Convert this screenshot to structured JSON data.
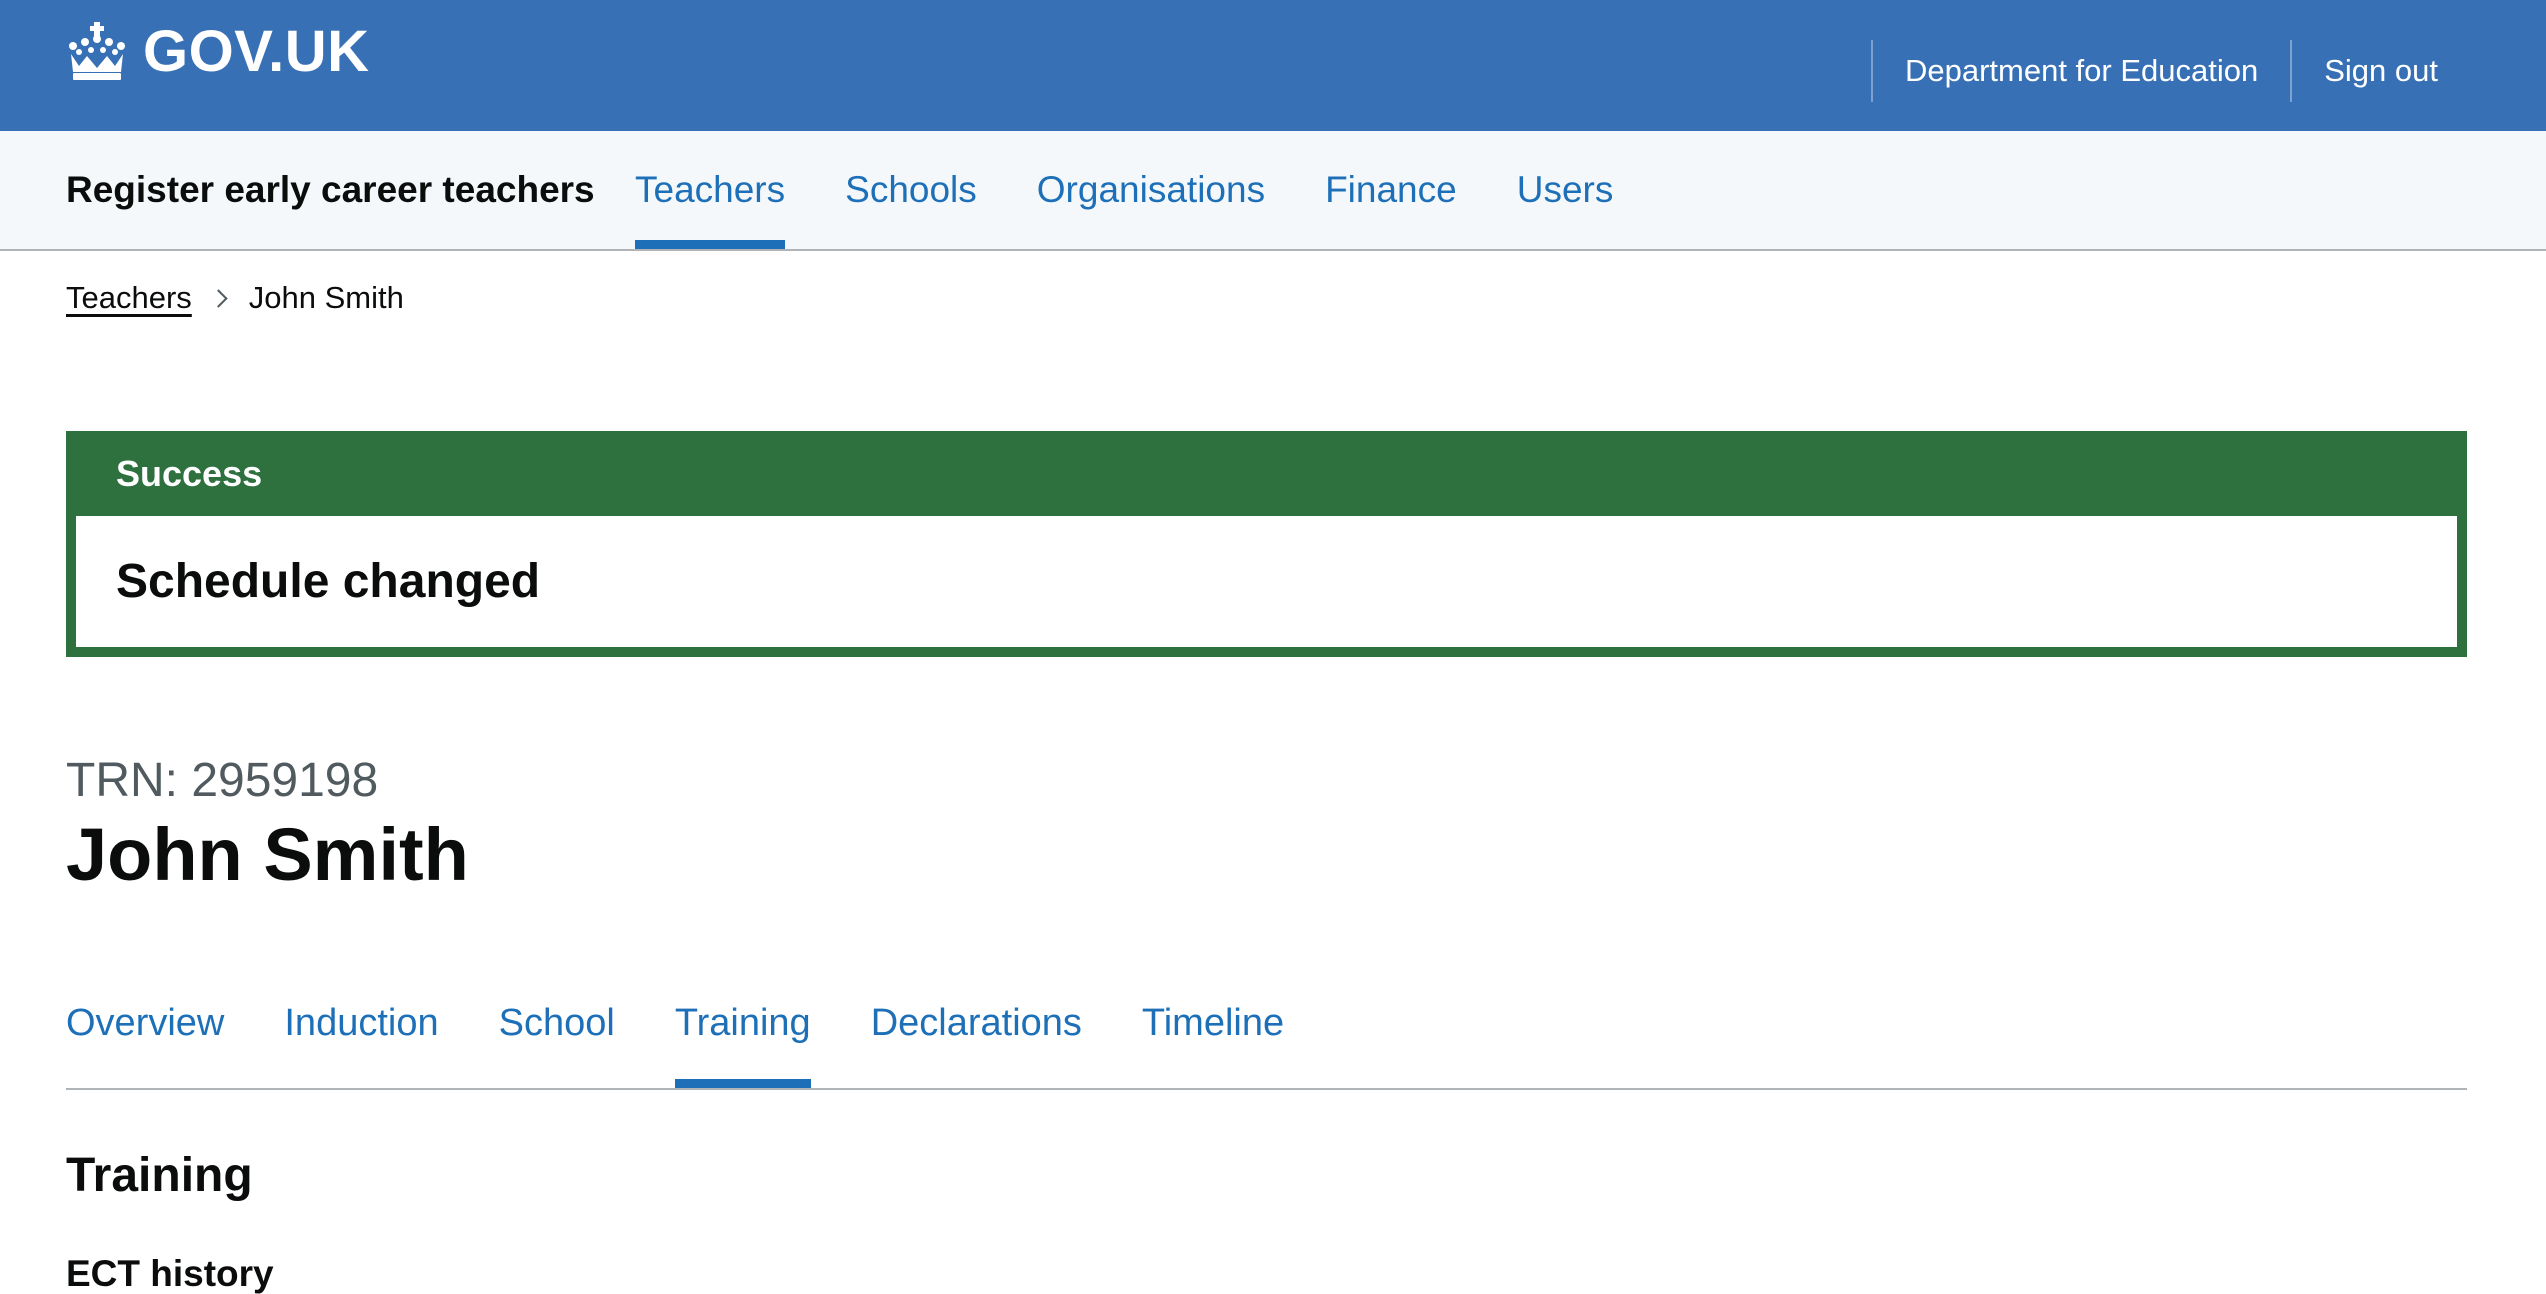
{
  "header": {
    "logo_text": "GOV.UK",
    "logo_icon": "crown-icon",
    "links": [
      {
        "label": "Department for Education"
      },
      {
        "label": "Sign out"
      }
    ]
  },
  "service_nav": {
    "service_name": "Register early career teachers",
    "items": [
      {
        "label": "Teachers",
        "active": true
      },
      {
        "label": "Schools",
        "active": false
      },
      {
        "label": "Organisations",
        "active": false
      },
      {
        "label": "Finance",
        "active": false
      },
      {
        "label": "Users",
        "active": false
      }
    ]
  },
  "breadcrumb": {
    "items": [
      {
        "label": "Teachers"
      },
      {
        "label": "John Smith"
      }
    ]
  },
  "banner": {
    "title": "Success",
    "heading": "Schedule changed"
  },
  "teacher": {
    "caption": "TRN: 2959198",
    "name": "John Smith"
  },
  "sub_nav": {
    "items": [
      {
        "label": "Overview",
        "active": false
      },
      {
        "label": "Induction",
        "active": false
      },
      {
        "label": "School",
        "active": false
      },
      {
        "label": "Training",
        "active": true
      },
      {
        "label": "Declarations",
        "active": false
      },
      {
        "label": "Timeline",
        "active": false
      }
    ]
  },
  "content": {
    "section_title": "Training",
    "sub_title": "ECT history"
  },
  "colors": {
    "header_blue": "#3870b6",
    "link_blue": "#1d70b8",
    "success_green": "#2e703e",
    "service_nav_bg": "#f4f8fb"
  }
}
